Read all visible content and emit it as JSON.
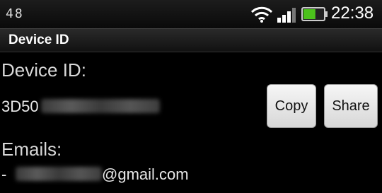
{
  "status_bar": {
    "left_indicator": "48",
    "time": "22:38",
    "icons": [
      "wifi-icon",
      "signal-icon",
      "battery-icon"
    ],
    "battery_level": 0.6
  },
  "title_bar": {
    "title": "Device ID"
  },
  "device": {
    "label": "Device ID:",
    "id_prefix": "3D50",
    "copy_label": "Copy",
    "share_label": "Share"
  },
  "emails": {
    "label": "Emails:",
    "item_prefix": "- ",
    "domain": "@gmail.com"
  },
  "colors": {
    "background": "#000000",
    "battery_fill": "#4cc21c",
    "button_bg": "#e6e6e6"
  }
}
